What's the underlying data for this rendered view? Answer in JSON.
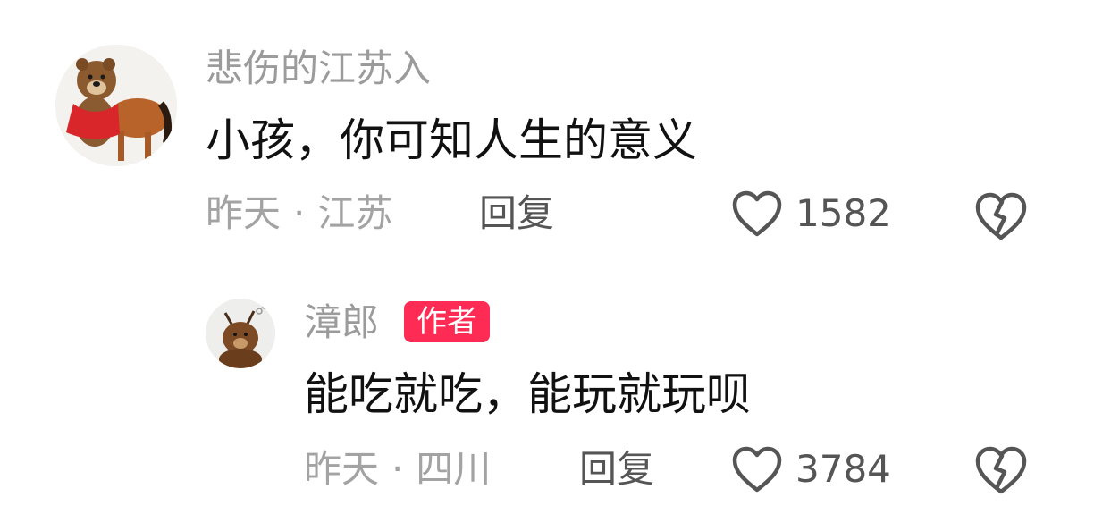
{
  "comments": [
    {
      "username": "悲伤的江苏入",
      "text": "小孩，你可知人生的意义",
      "time": "昨天",
      "separator": "·",
      "location": "江苏",
      "reply_label": "回复",
      "likes": "1582",
      "avatar_icon": "bear-horse-avatar"
    }
  ],
  "replies": [
    {
      "username": "漳郎",
      "badge": "作者",
      "text": "能吃就吃，能玩就玩呗",
      "time": "昨天",
      "separator": "·",
      "location": "四川",
      "reply_label": "回复",
      "likes": "3784",
      "avatar_icon": "bear-avatar"
    }
  ],
  "colors": {
    "badge": "#fe2c55",
    "username": "#9b9b9b",
    "content": "#111111",
    "meta": "#a3a3a3",
    "action": "#555555"
  },
  "icons": {
    "like": "heart-outline-icon",
    "dislike": "broken-heart-icon"
  }
}
